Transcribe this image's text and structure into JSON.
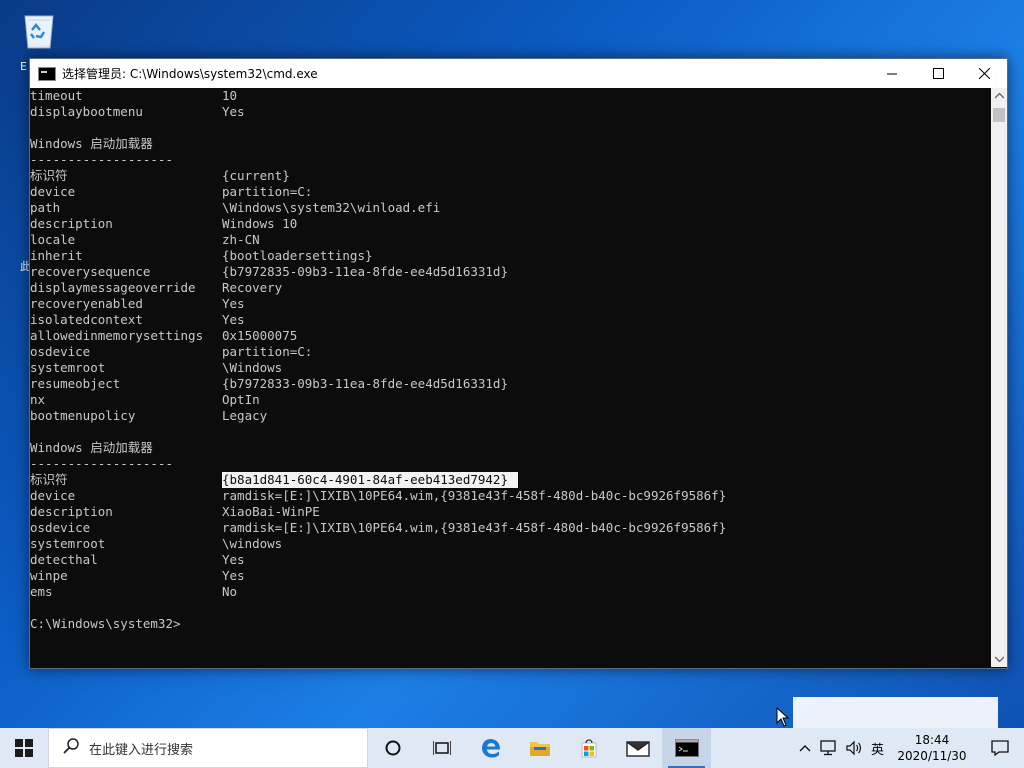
{
  "window": {
    "title": "选择管理员: C:\\Windows\\system32\\cmd.exe"
  },
  "console_lines": [
    {
      "key": "timeout",
      "value": "10"
    },
    {
      "key": "displaybootmenu",
      "value": "Yes"
    },
    {
      "key": "",
      "value": ""
    },
    {
      "key": "Windows 启动加载器",
      "value": ""
    },
    {
      "key": "-------------------",
      "value": ""
    },
    {
      "key": "标识符",
      "value": "{current}"
    },
    {
      "key": "device",
      "value": "partition=C:"
    },
    {
      "key": "path",
      "value": "\\Windows\\system32\\winload.efi"
    },
    {
      "key": "description",
      "value": "Windows 10"
    },
    {
      "key": "locale",
      "value": "zh-CN"
    },
    {
      "key": "inherit",
      "value": "{bootloadersettings}"
    },
    {
      "key": "recoverysequence",
      "value": "{b7972835-09b3-11ea-8fde-ee4d5d16331d}"
    },
    {
      "key": "displaymessageoverride",
      "value": "Recovery"
    },
    {
      "key": "recoveryenabled",
      "value": "Yes"
    },
    {
      "key": "isolatedcontext",
      "value": "Yes"
    },
    {
      "key": "allowedinmemorysettings",
      "value": "0x15000075"
    },
    {
      "key": "osdevice",
      "value": "partition=C:"
    },
    {
      "key": "systemroot",
      "value": "\\Windows"
    },
    {
      "key": "resumeobject",
      "value": "{b7972833-09b3-11ea-8fde-ee4d5d16331d}"
    },
    {
      "key": "nx",
      "value": "OptIn"
    },
    {
      "key": "bootmenupolicy",
      "value": "Legacy"
    },
    {
      "key": "",
      "value": ""
    },
    {
      "key": "Windows 启动加载器",
      "value": ""
    },
    {
      "key": "-------------------",
      "value": ""
    },
    {
      "key": "标识符",
      "value": "{b8a1d841-60c4-4901-84af-eeb413ed7942}",
      "selected": true
    },
    {
      "key": "device",
      "value": "ramdisk=[E:]\\IXIB\\10PE64.wim,{9381e43f-458f-480d-b40c-bc9926f9586f}"
    },
    {
      "key": "description",
      "value": "XiaoBai-WinPE"
    },
    {
      "key": "osdevice",
      "value": "ramdisk=[E:]\\IXIB\\10PE64.wim,{9381e43f-458f-480d-b40c-bc9926f9586f}"
    },
    {
      "key": "systemroot",
      "value": "\\windows"
    },
    {
      "key": "detecthal",
      "value": "Yes"
    },
    {
      "key": "winpe",
      "value": "Yes"
    },
    {
      "key": "ems",
      "value": "No"
    },
    {
      "key": "",
      "value": ""
    },
    {
      "key": "C:\\Windows\\system32>",
      "value": ""
    }
  ],
  "desktop": {
    "fragment_1": "E",
    "fragment_2": "此"
  },
  "taskbar": {
    "search_placeholder": "在此键入进行搜索",
    "ime_label": "英",
    "time": "18:44",
    "date": "2020/11/30"
  },
  "colors": {
    "console_bg": "#0c0c0c",
    "console_text": "#c8c8c8",
    "taskbar_bg": "#dfe9f5",
    "accent": "#0078d7"
  }
}
